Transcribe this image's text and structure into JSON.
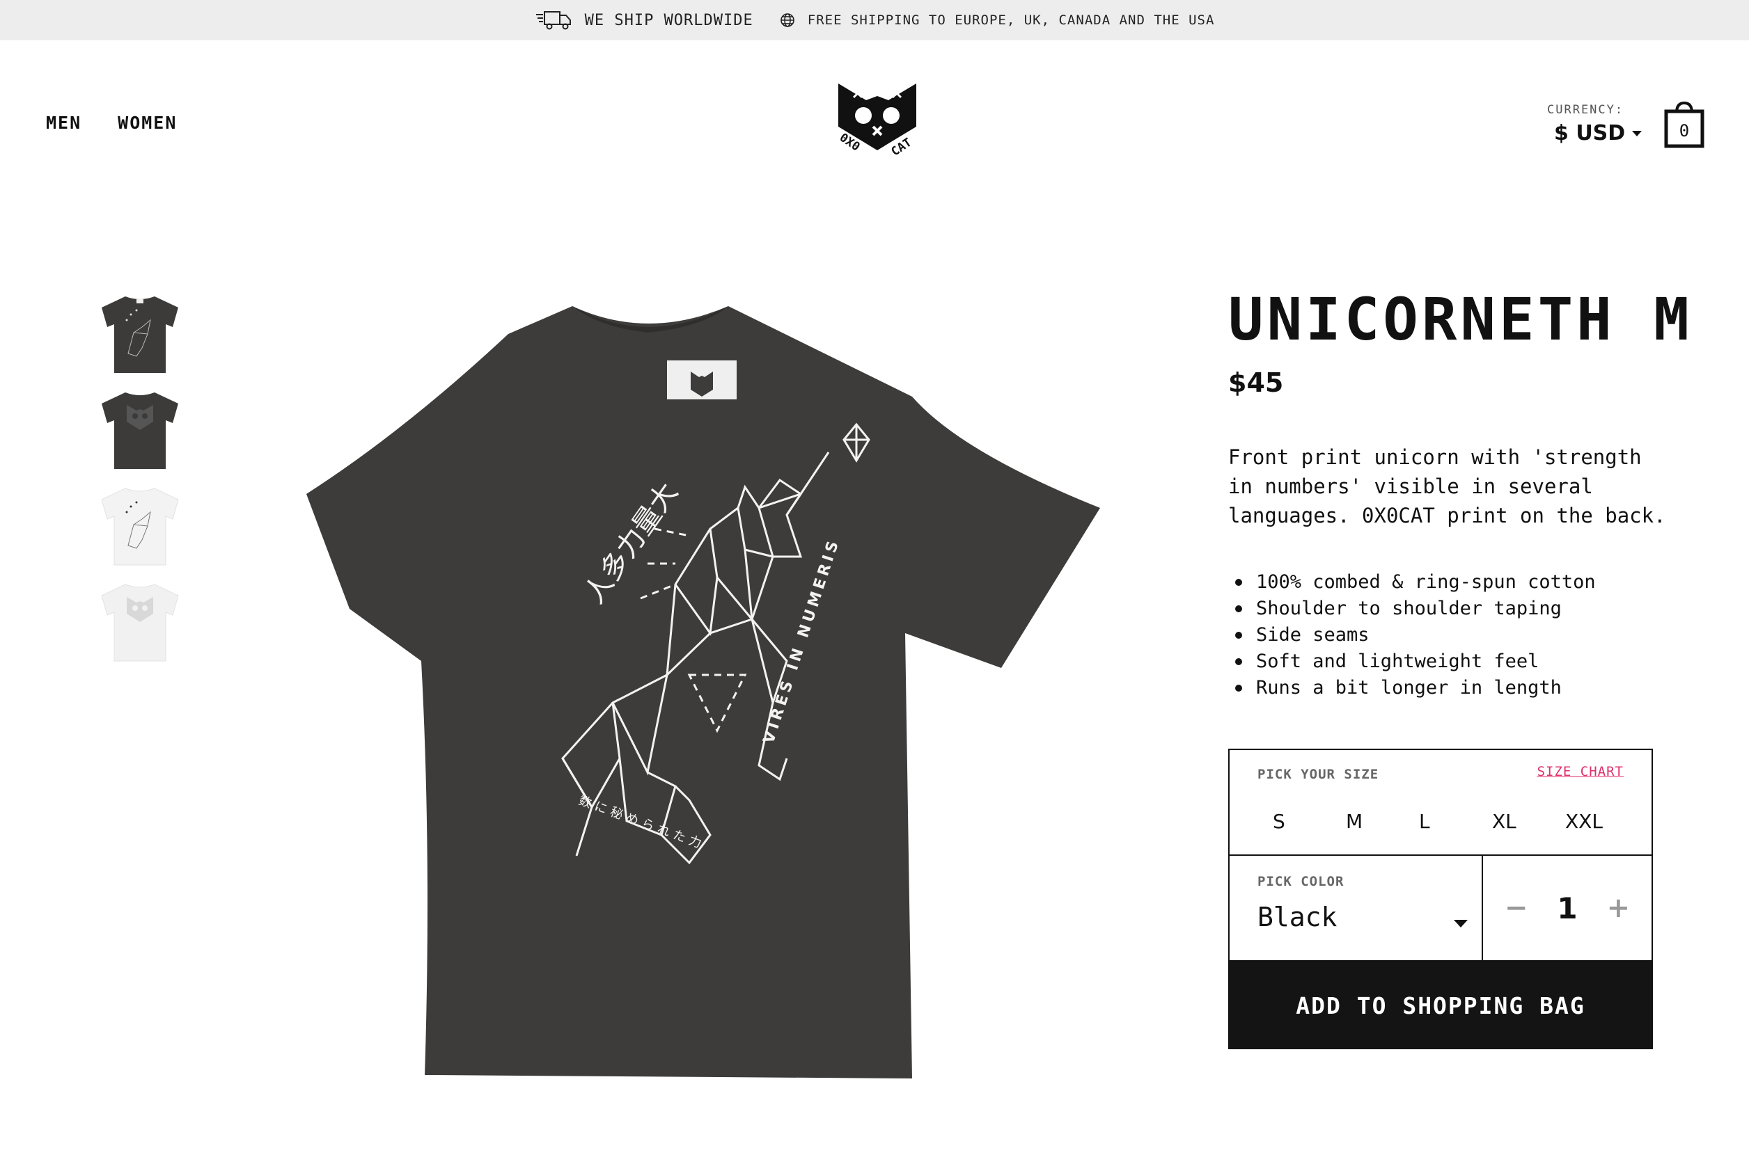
{
  "topbar": {
    "ship": "WE SHIP WORLDWIDE",
    "free": "FREE SHIPPING TO EUROPE, UK, CANADA AND THE USA"
  },
  "nav": {
    "men": "MEN",
    "women": "WOMEN"
  },
  "logo_text": "0X0 CAT",
  "currency": {
    "label": "CURRENCY:",
    "value": "$ USD"
  },
  "bag": {
    "count": "0"
  },
  "thumbnails": [
    {
      "color": "#3c3b39",
      "print": "unicorn"
    },
    {
      "color": "#3c3b39",
      "print": "logo"
    },
    {
      "color": "#f3f3f3",
      "print": "unicorn"
    },
    {
      "color": "#f3f3f3",
      "print": "logo"
    }
  ],
  "hero": {
    "shirt_color": "#3d3c3a",
    "print_text_right": "VIRES IN NUMERIS",
    "print_text_bottom": "数に秘められた力",
    "print_text_top": "人多力量大"
  },
  "product": {
    "title": "UNICORNETH M",
    "price": "$45",
    "description": "Front print unicorn with 'strength in numbers' visible in several languages. 0X0CAT print on the back.",
    "features": [
      "100% combed & ring-spun cotton",
      "Shoulder to shoulder taping",
      "Side seams",
      "Soft and lightweight feel",
      "Runs a bit longer in length"
    ]
  },
  "options": {
    "size_label": "PICK YOUR SIZE",
    "size_chart": "SIZE CHART",
    "sizes": [
      "S",
      "M",
      "L",
      "XL",
      "XXL"
    ],
    "color_label": "PICK COLOR",
    "color_value": "Black",
    "qty_minus": "−",
    "qty_value": "1",
    "qty_plus": "+",
    "add_button": "ADD TO SHOPPING BAG"
  },
  "colors": {
    "accent": "#e0306a",
    "button_bg": "#141414",
    "topbar_bg": "#ededed"
  }
}
